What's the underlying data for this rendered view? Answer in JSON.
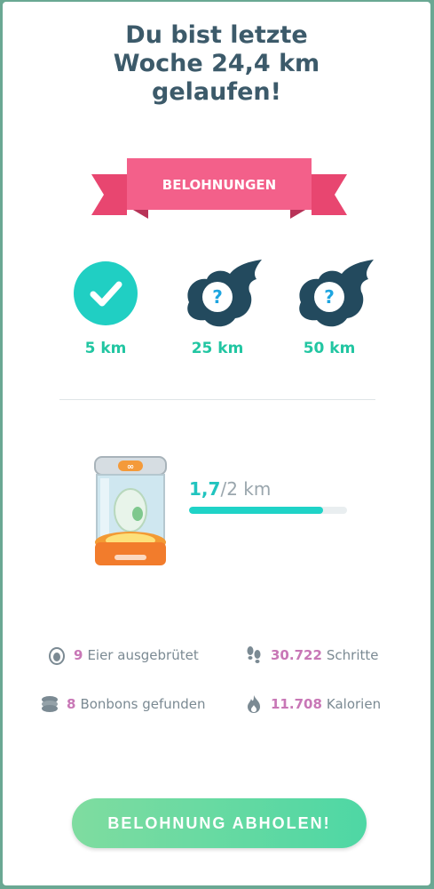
{
  "header": {
    "title_line1": "Du bist letzte",
    "title_line2": "Woche 24,4 km",
    "title_line3": "gelaufen!"
  },
  "rewards_banner": {
    "label": "BELOHNUNGEN"
  },
  "milestones": [
    {
      "label": "5 km",
      "status": "completed",
      "icon": "checkmark-icon"
    },
    {
      "label": "25 km",
      "status": "unknown",
      "icon": "mystery-reward-icon"
    },
    {
      "label": "50 km",
      "status": "unknown",
      "icon": "mystery-reward-icon"
    }
  ],
  "incubator": {
    "current": "1,7",
    "separator": "/",
    "total": "2 km",
    "progress_fraction": 0.85
  },
  "stats": {
    "eggs_num": "9",
    "eggs_label": "Eier ausgebrütet",
    "steps_num": "30.722",
    "steps_label": "Schritte",
    "candies_num": "8",
    "candies_label": "Bonbons gefunden",
    "calories_num": "11.708",
    "calories_label": "Kalorien"
  },
  "claim_button": {
    "label": "BELOHNUNG ABHOLEN!"
  },
  "colors": {
    "accent_teal": "#22c6a2",
    "banner_pink": "#f1547e",
    "stat_value_pink": "#c877b6",
    "mystery_dark": "#234a5e"
  }
}
